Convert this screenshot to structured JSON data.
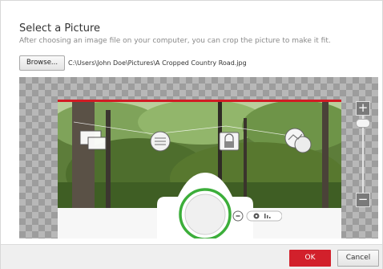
{
  "dialog": {
    "title": "Select a Picture",
    "subtitle": "After choosing an image file on your computer, you can crop the picture to make it fit."
  },
  "file": {
    "browse_label": "Browse...",
    "path": "C:\\Users\\John Doe\\Pictures\\A Cropped Country Road.jpg"
  },
  "zoom": {
    "plus_label": "+",
    "minus_label": "−",
    "level": 0.1
  },
  "icons": [
    "monitor-icon",
    "chat-bubble-icon",
    "lock-icon",
    "chart-icon",
    "minus-circle-icon",
    "settings-icon",
    "bar-chart-icon"
  ],
  "colors": {
    "accent_red": "#d2202b",
    "progress_green": "#3cae3a"
  },
  "footer": {
    "ok_label": "OK",
    "cancel_label": "Cancel"
  }
}
